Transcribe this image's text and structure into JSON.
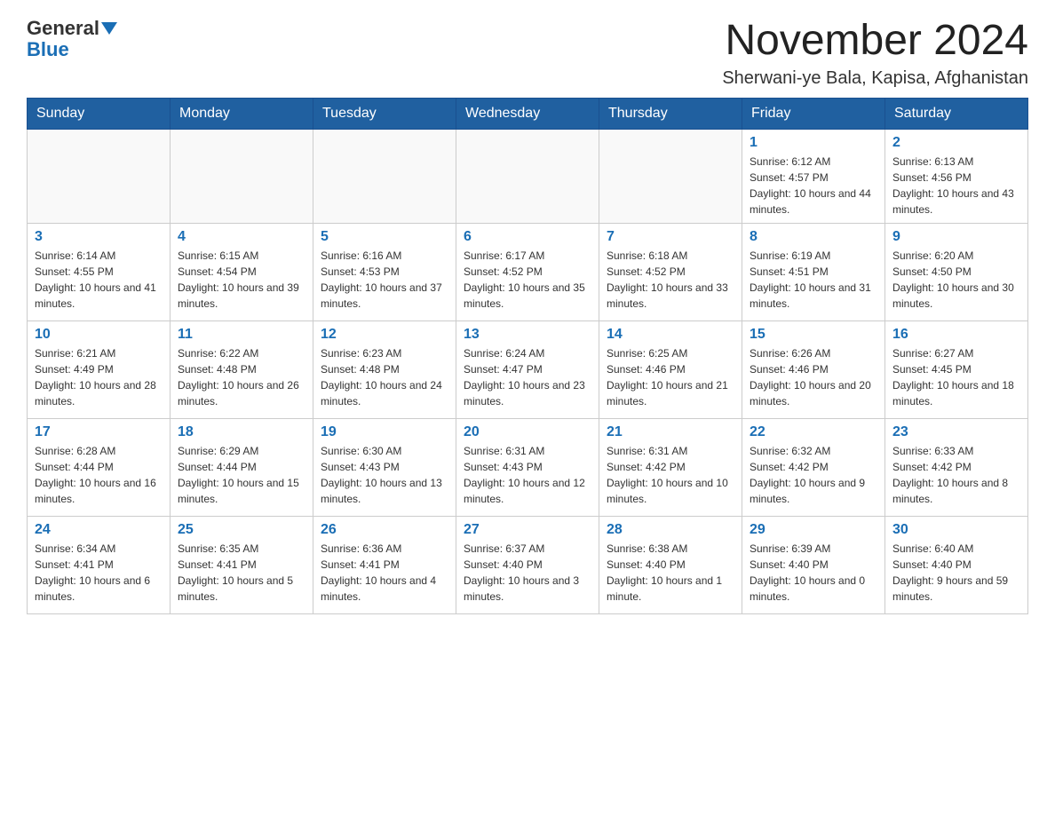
{
  "logo": {
    "general": "General",
    "blue": "Blue"
  },
  "title": "November 2024",
  "location": "Sherwani-ye Bala, Kapisa, Afghanistan",
  "days_of_week": [
    "Sunday",
    "Monday",
    "Tuesday",
    "Wednesday",
    "Thursday",
    "Friday",
    "Saturday"
  ],
  "weeks": [
    [
      {
        "day": "",
        "info": ""
      },
      {
        "day": "",
        "info": ""
      },
      {
        "day": "",
        "info": ""
      },
      {
        "day": "",
        "info": ""
      },
      {
        "day": "",
        "info": ""
      },
      {
        "day": "1",
        "info": "Sunrise: 6:12 AM\nSunset: 4:57 PM\nDaylight: 10 hours and 44 minutes."
      },
      {
        "day": "2",
        "info": "Sunrise: 6:13 AM\nSunset: 4:56 PM\nDaylight: 10 hours and 43 minutes."
      }
    ],
    [
      {
        "day": "3",
        "info": "Sunrise: 6:14 AM\nSunset: 4:55 PM\nDaylight: 10 hours and 41 minutes."
      },
      {
        "day": "4",
        "info": "Sunrise: 6:15 AM\nSunset: 4:54 PM\nDaylight: 10 hours and 39 minutes."
      },
      {
        "day": "5",
        "info": "Sunrise: 6:16 AM\nSunset: 4:53 PM\nDaylight: 10 hours and 37 minutes."
      },
      {
        "day": "6",
        "info": "Sunrise: 6:17 AM\nSunset: 4:52 PM\nDaylight: 10 hours and 35 minutes."
      },
      {
        "day": "7",
        "info": "Sunrise: 6:18 AM\nSunset: 4:52 PM\nDaylight: 10 hours and 33 minutes."
      },
      {
        "day": "8",
        "info": "Sunrise: 6:19 AM\nSunset: 4:51 PM\nDaylight: 10 hours and 31 minutes."
      },
      {
        "day": "9",
        "info": "Sunrise: 6:20 AM\nSunset: 4:50 PM\nDaylight: 10 hours and 30 minutes."
      }
    ],
    [
      {
        "day": "10",
        "info": "Sunrise: 6:21 AM\nSunset: 4:49 PM\nDaylight: 10 hours and 28 minutes."
      },
      {
        "day": "11",
        "info": "Sunrise: 6:22 AM\nSunset: 4:48 PM\nDaylight: 10 hours and 26 minutes."
      },
      {
        "day": "12",
        "info": "Sunrise: 6:23 AM\nSunset: 4:48 PM\nDaylight: 10 hours and 24 minutes."
      },
      {
        "day": "13",
        "info": "Sunrise: 6:24 AM\nSunset: 4:47 PM\nDaylight: 10 hours and 23 minutes."
      },
      {
        "day": "14",
        "info": "Sunrise: 6:25 AM\nSunset: 4:46 PM\nDaylight: 10 hours and 21 minutes."
      },
      {
        "day": "15",
        "info": "Sunrise: 6:26 AM\nSunset: 4:46 PM\nDaylight: 10 hours and 20 minutes."
      },
      {
        "day": "16",
        "info": "Sunrise: 6:27 AM\nSunset: 4:45 PM\nDaylight: 10 hours and 18 minutes."
      }
    ],
    [
      {
        "day": "17",
        "info": "Sunrise: 6:28 AM\nSunset: 4:44 PM\nDaylight: 10 hours and 16 minutes."
      },
      {
        "day": "18",
        "info": "Sunrise: 6:29 AM\nSunset: 4:44 PM\nDaylight: 10 hours and 15 minutes."
      },
      {
        "day": "19",
        "info": "Sunrise: 6:30 AM\nSunset: 4:43 PM\nDaylight: 10 hours and 13 minutes."
      },
      {
        "day": "20",
        "info": "Sunrise: 6:31 AM\nSunset: 4:43 PM\nDaylight: 10 hours and 12 minutes."
      },
      {
        "day": "21",
        "info": "Sunrise: 6:31 AM\nSunset: 4:42 PM\nDaylight: 10 hours and 10 minutes."
      },
      {
        "day": "22",
        "info": "Sunrise: 6:32 AM\nSunset: 4:42 PM\nDaylight: 10 hours and 9 minutes."
      },
      {
        "day": "23",
        "info": "Sunrise: 6:33 AM\nSunset: 4:42 PM\nDaylight: 10 hours and 8 minutes."
      }
    ],
    [
      {
        "day": "24",
        "info": "Sunrise: 6:34 AM\nSunset: 4:41 PM\nDaylight: 10 hours and 6 minutes."
      },
      {
        "day": "25",
        "info": "Sunrise: 6:35 AM\nSunset: 4:41 PM\nDaylight: 10 hours and 5 minutes."
      },
      {
        "day": "26",
        "info": "Sunrise: 6:36 AM\nSunset: 4:41 PM\nDaylight: 10 hours and 4 minutes."
      },
      {
        "day": "27",
        "info": "Sunrise: 6:37 AM\nSunset: 4:40 PM\nDaylight: 10 hours and 3 minutes."
      },
      {
        "day": "28",
        "info": "Sunrise: 6:38 AM\nSunset: 4:40 PM\nDaylight: 10 hours and 1 minute."
      },
      {
        "day": "29",
        "info": "Sunrise: 6:39 AM\nSunset: 4:40 PM\nDaylight: 10 hours and 0 minutes."
      },
      {
        "day": "30",
        "info": "Sunrise: 6:40 AM\nSunset: 4:40 PM\nDaylight: 9 hours and 59 minutes."
      }
    ]
  ]
}
